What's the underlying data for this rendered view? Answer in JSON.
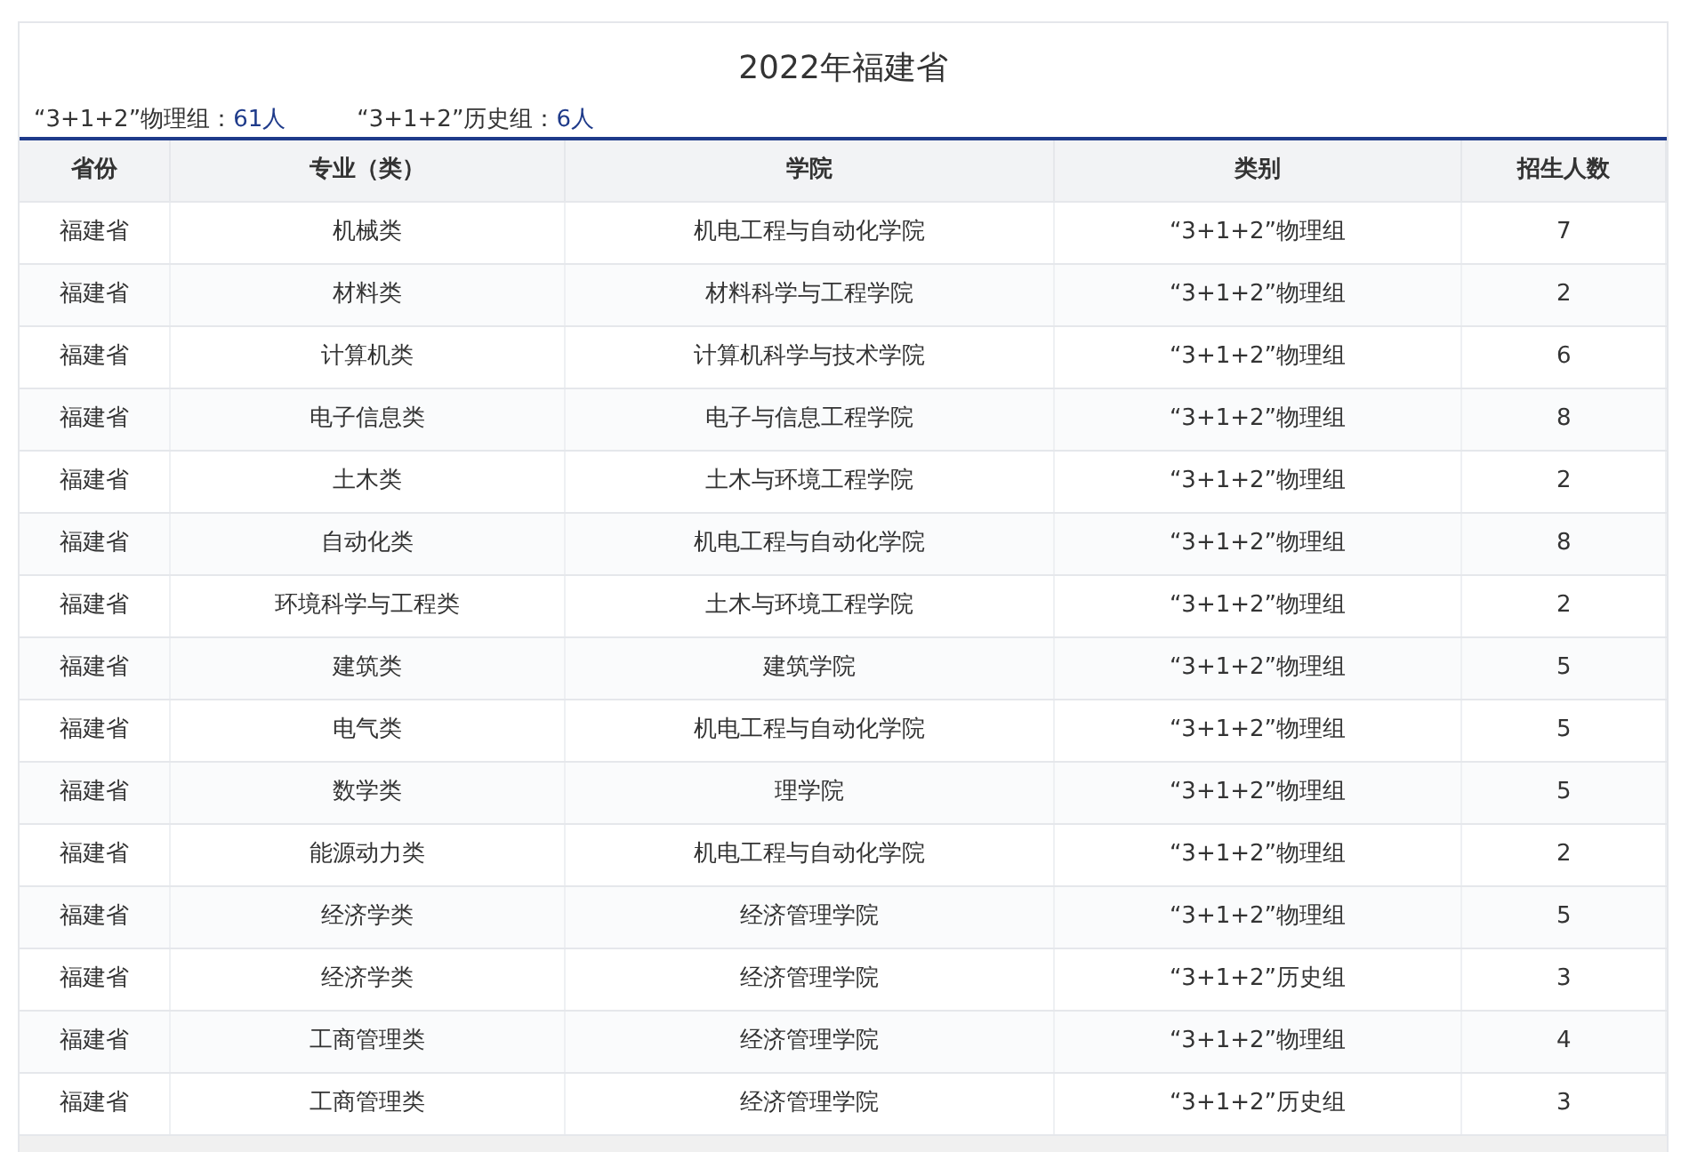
{
  "title": "2022年福建省",
  "summary": [
    {
      "label": "“3+1+2”物理组：",
      "value": "61人"
    },
    {
      "label": "“3+1+2”历史组：",
      "value": "6人"
    }
  ],
  "table": {
    "columns": [
      "省份",
      "专业（类）",
      "学院",
      "类别",
      "招生人数"
    ],
    "rows": [
      [
        "福建省",
        "机械类",
        "机电工程与自动化学院",
        "“3+1+2”物理组",
        "7"
      ],
      [
        "福建省",
        "材料类",
        "材料科学与工程学院",
        "“3+1+2”物理组",
        "2"
      ],
      [
        "福建省",
        "计算机类",
        "计算机科学与技术学院",
        "“3+1+2”物理组",
        "6"
      ],
      [
        "福建省",
        "电子信息类",
        "电子与信息工程学院",
        "“3+1+2”物理组",
        "8"
      ],
      [
        "福建省",
        "土木类",
        "土木与环境工程学院",
        "“3+1+2”物理组",
        "2"
      ],
      [
        "福建省",
        "自动化类",
        "机电工程与自动化学院",
        "“3+1+2”物理组",
        "8"
      ],
      [
        "福建省",
        "环境科学与工程类",
        "土木与环境工程学院",
        "“3+1+2”物理组",
        "2"
      ],
      [
        "福建省",
        "建筑类",
        "建筑学院",
        "“3+1+2”物理组",
        "5"
      ],
      [
        "福建省",
        "电气类",
        "机电工程与自动化学院",
        "“3+1+2”物理组",
        "5"
      ],
      [
        "福建省",
        "数学类",
        "理学院",
        "“3+1+2”物理组",
        "5"
      ],
      [
        "福建省",
        "能源动力类",
        "机电工程与自动化学院",
        "“3+1+2”物理组",
        "2"
      ],
      [
        "福建省",
        "经济学类",
        "经济管理学院",
        "“3+1+2”物理组",
        "5"
      ],
      [
        "福建省",
        "经济学类",
        "经济管理学院",
        "“3+1+2”历史组",
        "3"
      ],
      [
        "福建省",
        "工商管理类",
        "经济管理学院",
        "“3+1+2”物理组",
        "4"
      ],
      [
        "福建省",
        "工商管理类",
        "经济管理学院",
        "“3+1+2”历史组",
        "3"
      ]
    ]
  }
}
